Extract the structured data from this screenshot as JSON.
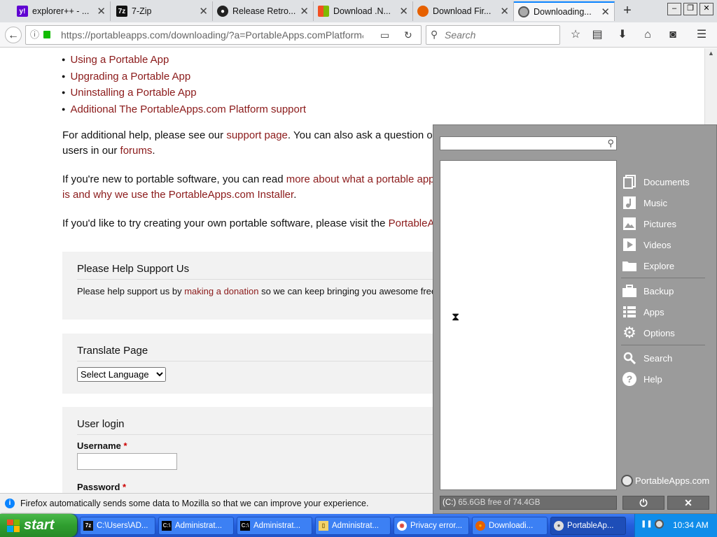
{
  "browser": {
    "tabs": [
      {
        "title": "explorer++ - ...",
        "icon": "yahoo-icon",
        "color": "#6001d2",
        "glyph": "y!"
      },
      {
        "title": "7-Zip",
        "icon": "7zip-icon",
        "color": "#111111",
        "glyph": "7z"
      },
      {
        "title": "Release Retro...",
        "icon": "github-icon",
        "color": "#222222",
        "glyph": "●"
      },
      {
        "title": "Download .N...",
        "icon": "microsoft-icon",
        "color": "#f25022",
        "glyph": "▦"
      },
      {
        "title": "Download Fir...",
        "icon": "firefox-icon",
        "color": "#e66000",
        "glyph": "●"
      },
      {
        "title": "Downloading...",
        "icon": "portableapps-icon",
        "color": "#888888",
        "glyph": "●"
      }
    ],
    "new_tab": "+",
    "window_controls": {
      "minimize": "–",
      "restore": "❐",
      "close": "✕"
    },
    "url": "https://portableapps.com/downloading/?a=PortableApps.comPlatform&",
    "search_placeholder": "Search",
    "accent": "#0a84ff"
  },
  "page": {
    "help_links": [
      "Using a Portable App",
      "Upgrading a Portable App",
      "Uninstalling a Portable App",
      "Additional The PortableApps.com Platform support"
    ],
    "para1": {
      "pre": "For additional help, please see our ",
      "link1": "support page",
      "mid": ". You can also ask a question o",
      "line2_pre": "users in our ",
      "link2": "forums",
      "post": "."
    },
    "para2": {
      "pre": "If you're new to portable software, you can read ",
      "link1": "more about what a portable app",
      "line2_link": "is and why we use the PortableApps.com Installer",
      "post": "."
    },
    "para3": {
      "pre": "If you'd like to try creating your own portable software, please visit the ",
      "link": "PortableA"
    },
    "support_block": {
      "title": "Please Help Support Us",
      "pre": "Please help support us by ",
      "link": "making a donation",
      "post": " so we can keep bringing you awesome free"
    },
    "translate_block": {
      "title": "Translate Page",
      "select_value": "Select Language"
    },
    "login_block": {
      "title": "User login",
      "username_label": "Username",
      "password_label": "Password",
      "required_mark": "*"
    }
  },
  "notification": {
    "text": "Firefox automatically sends some data to Mozilla so that we can improve your experience."
  },
  "portableapps_menu": {
    "items": [
      {
        "label": "Documents",
        "icon": "documents-icon"
      },
      {
        "label": "Music",
        "icon": "music-icon"
      },
      {
        "label": "Pictures",
        "icon": "pictures-icon"
      },
      {
        "label": "Videos",
        "icon": "videos-icon"
      },
      {
        "label": "Explore",
        "icon": "folder-icon"
      },
      {
        "label": "Backup",
        "icon": "briefcase-icon"
      },
      {
        "label": "Apps",
        "icon": "apps-list-icon"
      },
      {
        "label": "Options",
        "icon": "gear-icon"
      },
      {
        "label": "Search",
        "icon": "search-icon"
      },
      {
        "label": "Help",
        "icon": "help-icon"
      }
    ],
    "brand": "PortableApps.com",
    "drive_letter": "(C:)",
    "drive_info": "65.6GB free of 74.4GB",
    "power_button": "⏻",
    "close_button": "✕"
  },
  "taskbar": {
    "start_label": "start",
    "items": [
      {
        "label": "C:\\Users\\AD...",
        "icon": "7zip-icon",
        "glyph": "7z"
      },
      {
        "label": "Administrat...",
        "icon": "cmd-icon",
        "glyph": "C:\\"
      },
      {
        "label": "Administrat...",
        "icon": "cmd-icon",
        "glyph": "C:\\"
      },
      {
        "label": "Administrat...",
        "icon": "folder-icon",
        "glyph": "▯"
      },
      {
        "label": "Privacy error...",
        "icon": "chrome-icon",
        "glyph": "◉"
      },
      {
        "label": "Downloadi...",
        "icon": "firefox-icon",
        "glyph": "●"
      },
      {
        "label": "PortableAp...",
        "icon": "portableapps-icon",
        "glyph": "●"
      }
    ],
    "clock": "10:34 AM"
  }
}
